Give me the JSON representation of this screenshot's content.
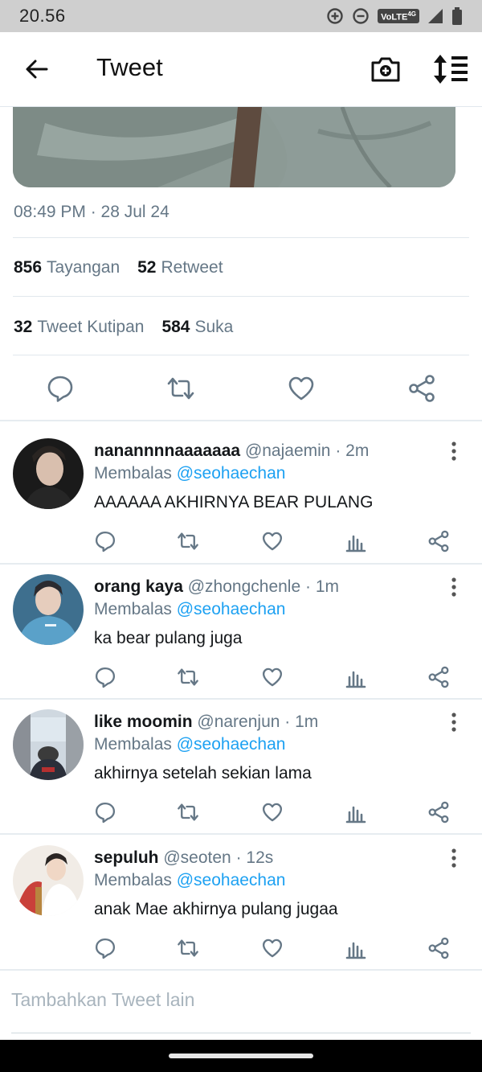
{
  "status_bar": {
    "time": "20.56",
    "network": "VoLTE",
    "network_gen": "4G"
  },
  "app_bar": {
    "title": "Tweet"
  },
  "tweet": {
    "timestamp": "08:49 PM · 28 Jul 24",
    "views_count": "856",
    "views_label": "Tayangan",
    "retweets_count": "52",
    "retweets_label": "Retweet",
    "quotes_count": "32",
    "quotes_label": "Tweet Kutipan",
    "likes_count": "584",
    "likes_label": "Suka"
  },
  "replies": [
    {
      "name": "nanannnnaaaaaaa",
      "handle": "@najaemin",
      "time": "· 2m",
      "replying_prefix": "Membalas",
      "replying_to": "@seohaechan",
      "text": "AAAAAA AKHIRNYA BEAR PULANG"
    },
    {
      "name": "orang kaya",
      "handle": "@zhongchenle",
      "time": "· 1m",
      "replying_prefix": "Membalas",
      "replying_to": "@seohaechan",
      "text": "ka bear pulang juga"
    },
    {
      "name": "like moomin",
      "handle": "@narenjun",
      "time": "· 1m",
      "replying_prefix": "Membalas",
      "replying_to": "@seohaechan",
      "text": "akhirnya setelah sekian lama"
    },
    {
      "name": "sepuluh",
      "handle": "@seoten",
      "time": "· 12s",
      "replying_prefix": "Membalas",
      "replying_to": "@seohaechan",
      "text": "anak Mae akhirnya pulang jugaa"
    }
  ],
  "composer": {
    "placeholder": "Tambahkan Tweet lain"
  },
  "colors": {
    "accent": "#1da1f2",
    "muted": "#657786",
    "icon": "#657786"
  }
}
